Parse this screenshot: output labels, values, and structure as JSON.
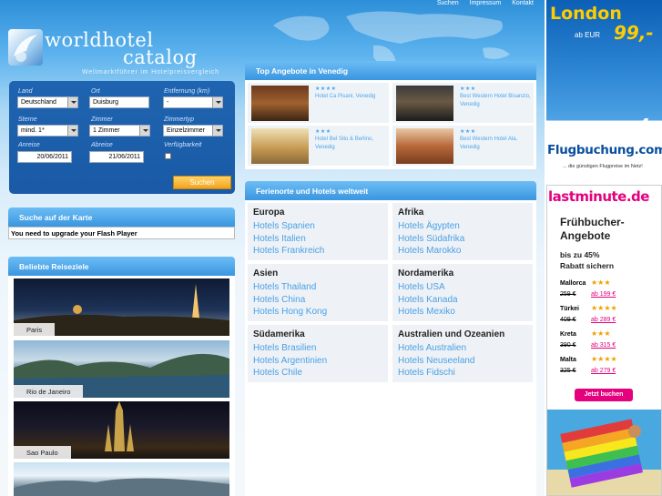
{
  "topnav": {
    "items": [
      "Suchen",
      "Impressum",
      "Kontakt"
    ]
  },
  "logo": {
    "line1": "worldhotel",
    "line2": "catalog"
  },
  "tagline": "Weltmarktführer im Hotelpreisvergleich",
  "search": {
    "land_label": "Land",
    "land_value": "Deutschland",
    "ort_label": "Ort",
    "ort_value": "Duisburg",
    "entfernung_label": "Entfernung (km)",
    "entfernung_value": "-",
    "sterne_label": "Sterne",
    "sterne_value": "mind. 1*",
    "zimmer_label": "Zimmer",
    "zimmer_value": "1 Zimmer",
    "zimmertyp_label": "Zimmertyp",
    "zimmertyp_value": "Einzelzimmer",
    "anreise_label": "Anreise",
    "anreise_value": "20/06/2011",
    "abreise_label": "Abreise",
    "abreise_value": "21/06/2011",
    "verfuegbarkeit_label": "Verfügbarkeit",
    "button": "Suchen"
  },
  "map": {
    "title": "Suche auf der Karte",
    "message": "You need to upgrade your Flash Player"
  },
  "destinations": {
    "title": "Beliebte Reiseziele",
    "items": [
      "Paris",
      "Rio de Janeiro",
      "Sao Paulo"
    ]
  },
  "offers": {
    "title": "Top Angebote in Venedig",
    "items": [
      {
        "stars": "★★★★",
        "name": "Hotel Ca Pisani, Venedig"
      },
      {
        "stars": "★★★",
        "name": "Best Western Hotel Bisanzio, Venedig"
      },
      {
        "stars": "★★★",
        "name": "Hotel Bel Sito & Berlino, Venedig"
      },
      {
        "stars": "★★★",
        "name": "Best Western Hotel Ala, Venedig"
      }
    ]
  },
  "regions": {
    "title": "Ferienorte und Hotels weltweit",
    "items": [
      {
        "name": "Europa",
        "links": [
          "Hotels Spanien",
          "Hotels Italien",
          "Hotels Frankreich"
        ]
      },
      {
        "name": "Afrika",
        "links": [
          "Hotels Ägypten",
          "Hotels Südafrika",
          "Hotels Marokko"
        ]
      },
      {
        "name": "Asien",
        "links": [
          "Hotels Thailand",
          "Hotels China",
          "Hotels Hong Kong"
        ]
      },
      {
        "name": "Nordamerika",
        "links": [
          "Hotels USA",
          "Hotels Kanada",
          "Hotels Mexiko"
        ]
      },
      {
        "name": "Südamerika",
        "links": [
          "Hotels Brasilien",
          "Hotels Argentinien",
          "Hotels Chile"
        ]
      },
      {
        "name": "Australien und Ozeanien",
        "links": [
          "Hotels Australien",
          "Hotels Neuseeland",
          "Hotels Fidschi"
        ]
      }
    ]
  },
  "ad1": {
    "city": "London",
    "prefix": "ab EUR",
    "price": "99,-",
    "brand": "Flugbuchung.com",
    "slogan": "... die günstigen Flugpreise im Netz!"
  },
  "ad2": {
    "brand": "lastminute.de",
    "headline": [
      "Frühbucher-",
      "Angebote"
    ],
    "sub": [
      "bis zu 45%",
      "Rabatt sichern"
    ],
    "deals": [
      {
        "place": "Mallorca",
        "stars": "★★★",
        "old": "259 €",
        "new": "ab 199 €"
      },
      {
        "place": "Türkei",
        "stars": "★★★★",
        "old": "409 €",
        "new": "ab 289 €"
      },
      {
        "place": "Kreta",
        "stars": "★★★",
        "old": "390 €",
        "new": "ab 315 €"
      },
      {
        "place": "Malta",
        "stars": "★★★★",
        "old": "325 €",
        "new": "ab 279 €"
      }
    ],
    "button": "Jetzt buchen"
  }
}
